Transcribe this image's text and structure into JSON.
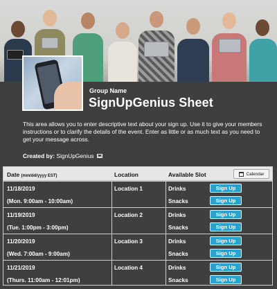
{
  "header": {
    "group_label": "Group Name",
    "title": "SignUpGenius Sheet",
    "description": "This area allows you to enter descriptive text about your sign up. Use it to give your members instructions or to clarify the details of the event. Enter as little or as much text as you need to get your message across.",
    "created_by_label": "Created by:",
    "created_by_name": "SignUpGenius"
  },
  "table": {
    "headers": {
      "date": "Date",
      "date_format": "(mm/dd/yyyy EST)",
      "location": "Location",
      "slot": "Available Slot",
      "calendar": "Calendar"
    },
    "rows": [
      {
        "date": "11/18/2019",
        "time": "(Mon. 9:00am - 10:00am)",
        "location": "Location 1",
        "slots": [
          {
            "name": "Drinks",
            "button": "Sign Up"
          },
          {
            "name": "Snacks",
            "button": "Sign Up"
          }
        ]
      },
      {
        "date": "11/19/2019",
        "time": "(Tue. 1:00pm - 3:00pm)",
        "location": "Location 2",
        "slots": [
          {
            "name": "Drinks",
            "button": "Sign Up"
          },
          {
            "name": "Snacks",
            "button": "Sign Up"
          }
        ]
      },
      {
        "date": "11/20/2019",
        "time": "(Wed. 7:00am - 9:00am)",
        "location": "Location 3",
        "slots": [
          {
            "name": "Drinks",
            "button": "Sign Up"
          },
          {
            "name": "Snacks",
            "button": "Sign Up"
          }
        ]
      },
      {
        "date": "11/21/2019",
        "time": "(Thurs. 11:00am - 12:01pm)",
        "location": "Location 4",
        "slots": [
          {
            "name": "Drinks",
            "button": "Sign Up"
          },
          {
            "name": "Snacks",
            "button": "Sign Up"
          }
        ]
      }
    ]
  },
  "icons": {
    "mail": "mail-icon",
    "calendar": "calendar-icon"
  },
  "colors": {
    "background": "#3f3f3f",
    "button": "#2aa2cf",
    "header_row": "#e7e7e7"
  }
}
